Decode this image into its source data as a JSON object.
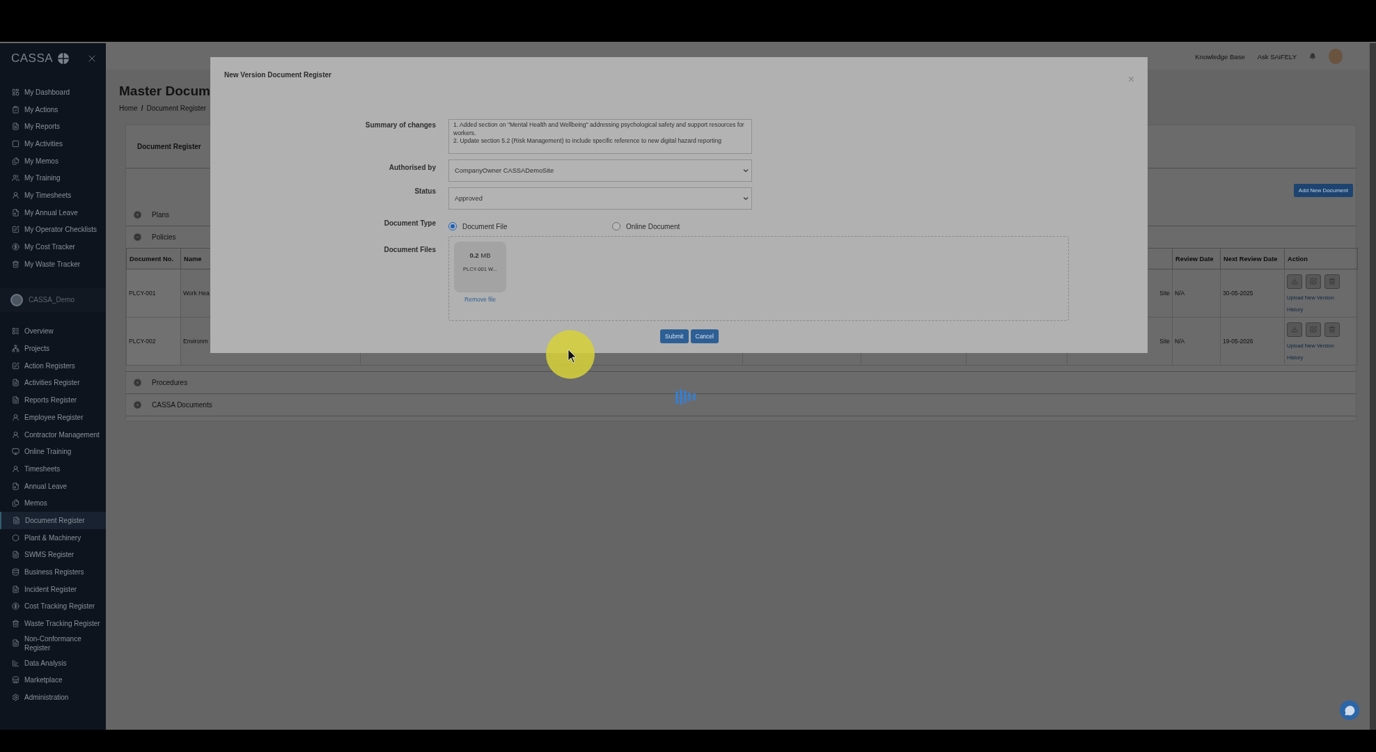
{
  "sidebar": {
    "brand": "CASSA",
    "personal_items": [
      {
        "label": "My Dashboard",
        "selected": false
      },
      {
        "label": "My Actions",
        "selected": false
      },
      {
        "label": "My Reports",
        "selected": false
      },
      {
        "label": "My Activities",
        "selected": false
      },
      {
        "label": "My Memos",
        "selected": false
      },
      {
        "label": "My Training",
        "selected": false
      },
      {
        "label": "My Timesheets",
        "selected": false
      },
      {
        "label": "My Annual Leave",
        "selected": false
      },
      {
        "label": "My Operator Checklists",
        "selected": false
      },
      {
        "label": "My Cost Tracker",
        "selected": false
      },
      {
        "label": "My Waste Tracker",
        "selected": false
      }
    ],
    "workspace": "CASSA_Demo",
    "items": [
      {
        "label": "Overview",
        "selected": false
      },
      {
        "label": "Projects",
        "selected": false
      },
      {
        "label": "Action Registers",
        "selected": false
      },
      {
        "label": "Activities Register",
        "selected": false
      },
      {
        "label": "Reports Register",
        "selected": false
      },
      {
        "label": "Employee Register",
        "selected": false
      },
      {
        "label": "Contractor Management",
        "selected": false
      },
      {
        "label": "Online Training",
        "selected": false
      },
      {
        "label": "Timesheets",
        "selected": false
      },
      {
        "label": "Annual Leave",
        "selected": false
      },
      {
        "label": "Memos",
        "selected": false
      },
      {
        "label": "Document Register",
        "selected": true
      },
      {
        "label": "Plant & Machinery",
        "selected": false
      },
      {
        "label": "SWMS Register",
        "selected": false
      },
      {
        "label": "Business Registers",
        "selected": false
      },
      {
        "label": "Incident Register",
        "selected": false
      },
      {
        "label": "Cost Tracking Register",
        "selected": false
      },
      {
        "label": "Waste Tracking Register",
        "selected": false
      },
      {
        "label": "Non-Conformance Register",
        "selected": false
      },
      {
        "label": "Data Analysis",
        "selected": false
      },
      {
        "label": "Marketplace",
        "selected": false
      },
      {
        "label": "Administration",
        "selected": false
      }
    ]
  },
  "header": {
    "links": [
      "Knowledge Base",
      "Ask SAiFELY"
    ]
  },
  "page": {
    "title": "Master Docum",
    "breadcrumb": [
      "Home",
      "Document Register"
    ],
    "separator": "/"
  },
  "card": {
    "title": "Document Register",
    "add_button": "Add New Document",
    "sections": [
      {
        "label": "Plans",
        "expanded": false
      },
      {
        "label": "Policies",
        "expanded": true,
        "table": {
          "columns": {
            "document_no": "Document No.",
            "name": "Name",
            "review_date": "Review Date",
            "next_review_date": "Next Review Date",
            "action": "Action"
          },
          "rows": [
            {
              "document_no": "PLCY-001",
              "name": "Work Hea",
              "column_7": "Site",
              "review_date": "N/A",
              "next_review_date": "30-05-2025",
              "links": [
                "Upload New Version",
                "History"
              ]
            },
            {
              "document_no": "PLCY-002",
              "name": "Environm",
              "column_7": "Site",
              "review_date": "N/A",
              "next_review_date": "19-05-2026",
              "links": [
                "Upload New Version",
                "History"
              ]
            }
          ]
        }
      },
      {
        "label": "Procedures",
        "expanded": false
      },
      {
        "label": "CASSA Documents",
        "expanded": false
      }
    ]
  },
  "modal": {
    "title": "New Version Document Register",
    "summary": {
      "label": "Summary of changes",
      "value": "1. Added section on \"Mental Health and Wellbeing\" addressing psychological safety and support resources for workers.\n2. Update section 5.2 (Risk Management) to include specific reference to new digital hazard reporting"
    },
    "authorised_by": {
      "label": "Authorised by",
      "value": "CompanyOwner CASSADemoSite"
    },
    "status": {
      "label": "Status",
      "value": "Approved"
    },
    "document_type": {
      "label": "Document Type",
      "options": [
        {
          "label": "Document File",
          "selected": true
        },
        {
          "label": "Online Document",
          "selected": false
        }
      ]
    },
    "document_files": {
      "label": "Document Files",
      "files": [
        {
          "size": "**0.2** MB",
          "name": "PLCY-001 W...",
          "remove": "Remove file"
        }
      ]
    },
    "buttons": {
      "submit": "Submit",
      "cancel": "Cancel"
    }
  }
}
